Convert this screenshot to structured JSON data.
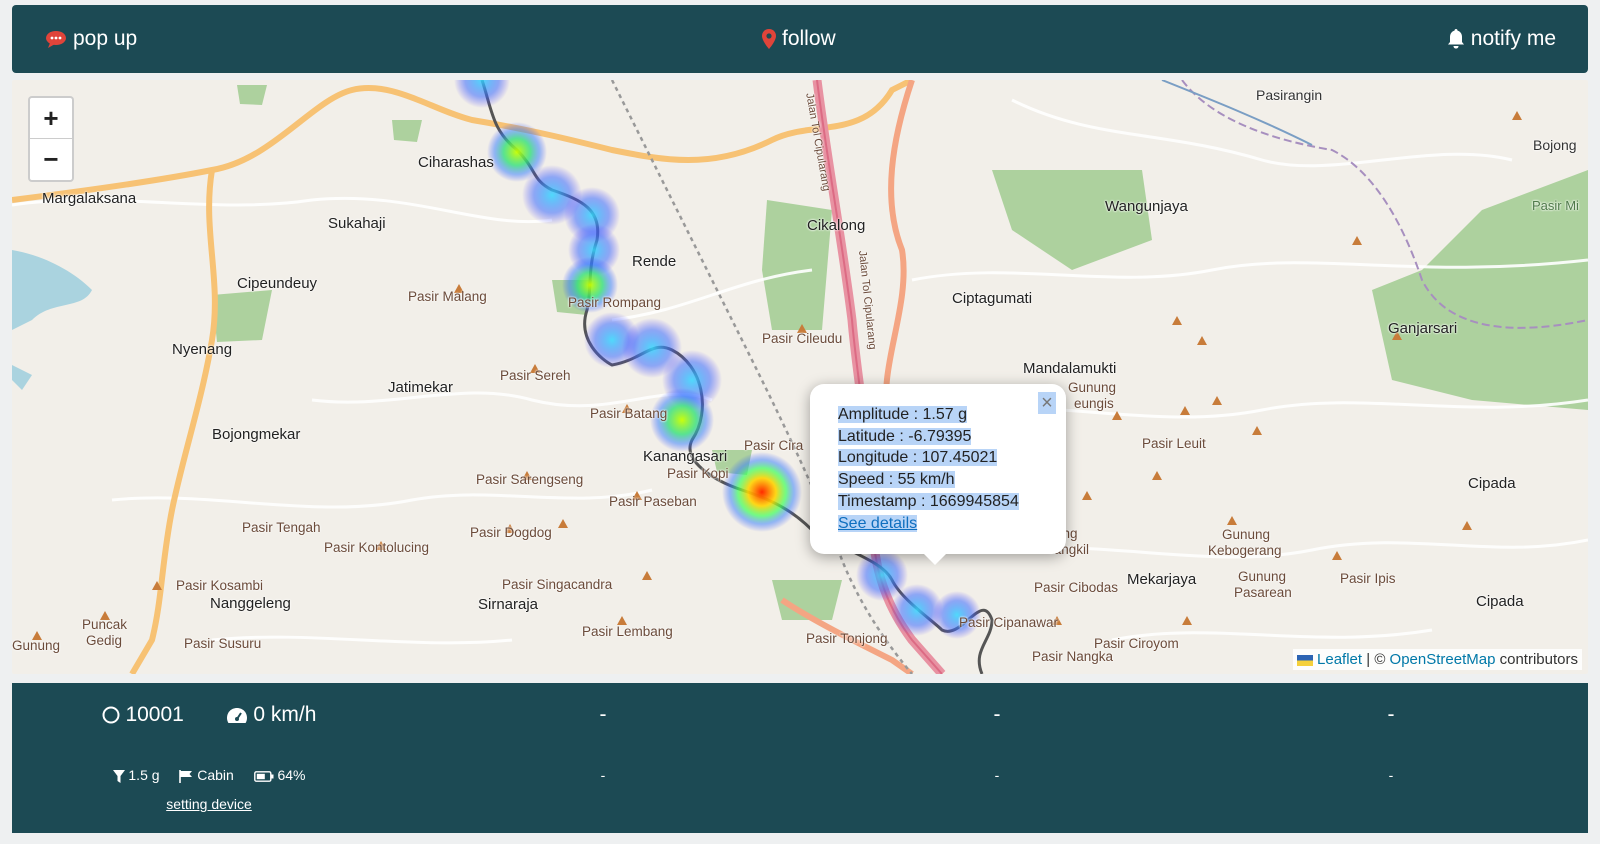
{
  "topbar": {
    "popup_label": "pop up",
    "follow_label": "follow",
    "notify_label": "notify me"
  },
  "map": {
    "zoom_in": "+",
    "zoom_out": "−",
    "labels": {
      "pasirangin": "Pasirangin",
      "bojong": "Bojong",
      "pasir_mi": "Pasir Mi",
      "ciharashas": "Ciharashas",
      "margalaksana": "Margalaksana",
      "sukahaji": "Sukahaji",
      "cikalong": "Cikalong",
      "wangunjaya": "Wangunjaya",
      "rende": "Rende",
      "cipeundeuy": "Cipeundeuy",
      "pasir_malang": "Pasir Malang",
      "pasir_rompang": "Pasir Rompang",
      "ciptagumati": "Ciptagumati",
      "ganjarsari": "Ganjarsari",
      "pasir_cileudu": "Pasir Cileudu",
      "nyenang": "Nyenang",
      "mandalamukti": "Mandalamukti",
      "jatimekar": "Jatimekar",
      "pasir_sereh": "Pasir Sereh",
      "gunung": "Gunung",
      "geungis": "eungis",
      "pasir_batang": "Pasir Batang",
      "bojongmekar": "Bojongmekar",
      "pasir_cira": "Pasir Cira",
      "pasir_leuit": "Pasir Leuit",
      "kanangasari": "Kanangasari",
      "pasir_kopi": "Pasir Kopi",
      "pasir_sarengseng": "Pasir Sarengseng",
      "pasir_paseban": "Pasir Paseban",
      "cipada1": "Cipada",
      "pasir_tengah": "Pasir Tengah",
      "pasir_dogdog": "Pasir Dogdog",
      "pasir_kontolucing": "Pasir Kontolucing",
      "gunung_tangkil_a": "ung",
      "gunung_tangkil_b": "Tangkil",
      "gunung_kebogerang_a": "Gunung",
      "gunung_kebogerang_b": "Kebogerang",
      "pasir_kosambi": "Pasir Kosambi",
      "pasir_singacandra": "Pasir Singacandra",
      "mekarjaya": "Mekarjaya",
      "pasir_cibodas": "Pasir Cibodas",
      "gunung_pasarean_a": "Gunung",
      "gunung_pasarean_b": "Pasarean",
      "pasir_ipis": "Pasir Ipis",
      "nanggeleng": "Nanggeleng",
      "sirnaraja": "Sirnaraja",
      "cipada2": "Cipada",
      "puncak": "Puncak",
      "gedig": "Gedig",
      "pasir_cipanawar": "Pasir Cipanawar",
      "pasir_lembang": "Pasir Lembang",
      "pasir_susuru": "Pasir Susuru",
      "pasir_tonjong": "Pasir Tonjong",
      "pasir_ciroyom": "Pasir Ciroyom",
      "pasir_nangka": "Pasir Nangka",
      "gunung_gaba_a": "Gunung",
      "jalan_tol_1": "Jalan Tol Cipularang",
      "jalan_tol_2": "Jalan Tol Cipularang"
    }
  },
  "popup": {
    "amplitude": "Amplitude : 1.57 g",
    "latitude": "Latitude : -6.79395",
    "longitude": "Longitude : 107.45021",
    "speed": "Speed : 55 km/h",
    "timestamp": "Timestamp : 1669945854",
    "details_link": "See details",
    "close": "×"
  },
  "attribution": {
    "leaflet": "Leaflet",
    "separator": "| ©",
    "osm": "OpenStreetMap",
    "contributors": "contributors"
  },
  "panels": [
    {
      "device_id": "10001",
      "speed": "0 km/h",
      "threshold": "1.5 g",
      "location": "Cabin",
      "battery": "64%",
      "setting_link": "setting device"
    },
    {
      "row1": "-",
      "row2": "-"
    },
    {
      "row1": "-",
      "row2": "-"
    },
    {
      "row1": "-",
      "row2": "-"
    }
  ]
}
